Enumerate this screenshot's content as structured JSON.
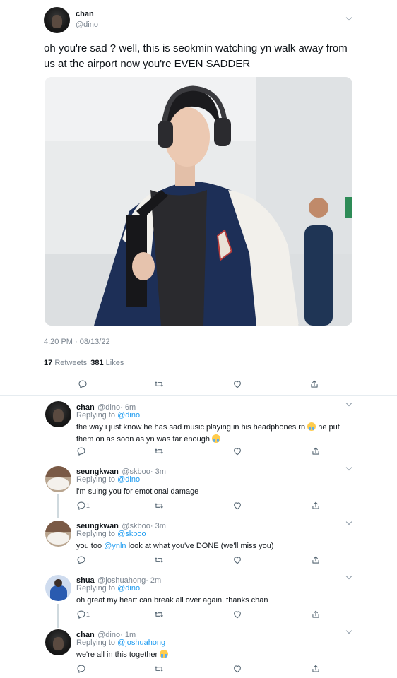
{
  "main_tweet": {
    "name": "chan",
    "handle": "@dino",
    "text": "oh you're sad ? well, this is seokmin watching yn walk away from us at the airport now you're EVEN SADDER",
    "timestamp": "4:20 PM · 08/13/22",
    "retweets_count": "17",
    "retweets_label": "Retweets",
    "likes_count": "381",
    "likes_label": "Likes"
  },
  "replies": [
    {
      "name": "chan",
      "handle": "@dino",
      "time": "· 6m",
      "replying_label": "Replying to",
      "replying_to": "@dino",
      "text_1": "the way i just know he has sad music playing in his headphones rn",
      "text_2": "he put",
      "text_3": "them on as soon as yn was far enough",
      "reply_count": "",
      "avatar": "chan-avatar"
    },
    {
      "name": "seungkwan",
      "handle": "@skboo",
      "time": "· 3m",
      "replying_label": "Replying to",
      "replying_to": "@dino",
      "text_1": "i'm suing you for emotional damage",
      "reply_count": "1",
      "avatar": "dog-avatar"
    },
    {
      "name": "seungkwan",
      "handle": "@skboo",
      "time": "· 3m",
      "replying_label": "Replying to",
      "replying_to": "@skboo",
      "text_1": "you too",
      "mention": "@ynln",
      "text_2": "look at what you've DONE (we'll miss you)",
      "reply_count": "",
      "avatar": "dog-avatar"
    },
    {
      "name": "shua",
      "handle": "@joshuahong",
      "time": "· 2m",
      "replying_label": "Replying to",
      "replying_to": "@dino",
      "text_1": "oh great my heart can break all over again, thanks chan",
      "reply_count": "1",
      "avatar": "shua-avatar"
    },
    {
      "name": "chan",
      "handle": "@dino",
      "time": "· 1m",
      "replying_label": "Replying to",
      "replying_to": "@joshuahong",
      "text_1": "we're all in this together",
      "reply_count": "",
      "avatar": "chan-avatar"
    }
  ],
  "icons": {
    "reply": "reply-icon",
    "retweet": "retweet-icon",
    "like": "heart-icon",
    "share": "share-icon",
    "more": "chevron-down-icon"
  },
  "colors": {
    "link": "#1d9bf0",
    "secondary_text": "#7b8590",
    "divider": "#e6ecf0"
  }
}
